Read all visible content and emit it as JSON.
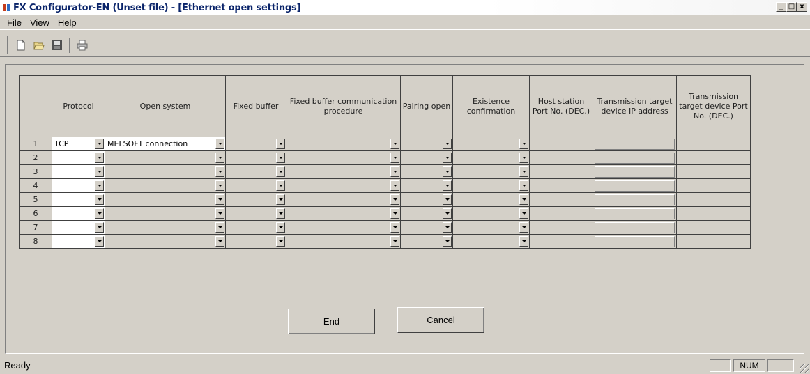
{
  "window": {
    "title": "FX Configurator-EN (Unset file) - [Ethernet open settings]",
    "minimize": "_",
    "restore": "□",
    "close": "x"
  },
  "menu": [
    "File",
    "View",
    "Help"
  ],
  "toolbar": {
    "icons": [
      "new-file-icon",
      "open-folder-icon",
      "save-icon",
      "print-icon"
    ]
  },
  "grid": {
    "headers": [
      "Protocol",
      "Open system",
      "Fixed buffer",
      "Fixed buffer communication procedure",
      "Pairing open",
      "Existence confirmation",
      "Host station Port No. (DEC.)",
      "Transmission target device IP address",
      "Transmission target device Port No. (DEC.)"
    ],
    "rows": [
      {
        "num": "1",
        "protocol": "TCP",
        "open_system": "MELSOFT connection"
      },
      {
        "num": "2",
        "protocol": "",
        "open_system": ""
      },
      {
        "num": "3",
        "protocol": "",
        "open_system": ""
      },
      {
        "num": "4",
        "protocol": "",
        "open_system": ""
      },
      {
        "num": "5",
        "protocol": "",
        "open_system": ""
      },
      {
        "num": "6",
        "protocol": "",
        "open_system": ""
      },
      {
        "num": "7",
        "protocol": "",
        "open_system": ""
      },
      {
        "num": "8",
        "protocol": "",
        "open_system": ""
      }
    ]
  },
  "buttons": {
    "end": "End",
    "cancel": "Cancel"
  },
  "status": {
    "text": "Ready",
    "num": "NUM"
  }
}
